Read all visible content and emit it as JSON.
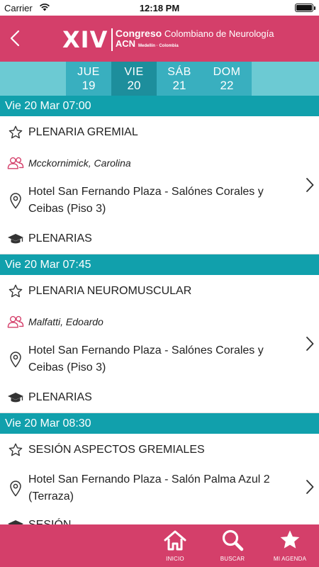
{
  "status_bar": {
    "carrier": "Carrier",
    "time": "12:18 PM"
  },
  "header": {
    "logo": {
      "roman": "XIV",
      "word_bold": "Congreso",
      "word_rest": "Colombiano de Neurología",
      "acronym": "ACN",
      "city": "Medellín · Colombia"
    }
  },
  "days": [
    {
      "name": "JUE",
      "num": "19",
      "active": false
    },
    {
      "name": "VIE",
      "num": "20",
      "active": true
    },
    {
      "name": "SÁB",
      "num": "21",
      "active": false
    },
    {
      "name": "DOM",
      "num": "22",
      "active": false
    }
  ],
  "sections": [
    {
      "header": "Vie 20 Mar 07:00",
      "title": "PLENARIA GREMIAL",
      "speaker": "Mcckornimick, Carolina",
      "place": "Hotel San Fernando Plaza - Salónes Corales y Ceibas (Piso 3)",
      "type": "PLENARIAS"
    },
    {
      "header": "Vie 20 Mar 07:45",
      "title": "PLENARIA NEUROMUSCULAR",
      "speaker": "Malfatti, Edoardo",
      "place": "Hotel San Fernando Plaza - Salónes Corales y Ceibas (Piso 3)",
      "type": "PLENARIAS"
    },
    {
      "header": "Vie 20 Mar 08:30",
      "title": "SESIÓN ASPECTOS GREMIALES",
      "place": "Hotel San Fernando Plaza - Salón Palma Azul 2 (Terraza)",
      "type": "SESIÓN"
    }
  ],
  "tabbar": {
    "inicio": "INICIO",
    "buscar": "BUSCAR",
    "mi_agenda": "MI AGENDA"
  },
  "colors": {
    "brand": "#d43f6a",
    "teal_header": "#11a0ac",
    "day_bar": "#6ccad3",
    "day_tab": "#39afbf",
    "day_tab_active": "#1d8e9c",
    "speaker_icon": "#d43f6a"
  },
  "icons": {
    "back": "chevron-left-icon",
    "favorite": "star-outline-icon",
    "speaker": "users-icon",
    "location": "map-pin-icon",
    "type": "graduation-cap-icon",
    "detail": "chevron-right-icon",
    "home": "home-icon",
    "search": "search-icon",
    "agenda": "star-filled-icon"
  }
}
